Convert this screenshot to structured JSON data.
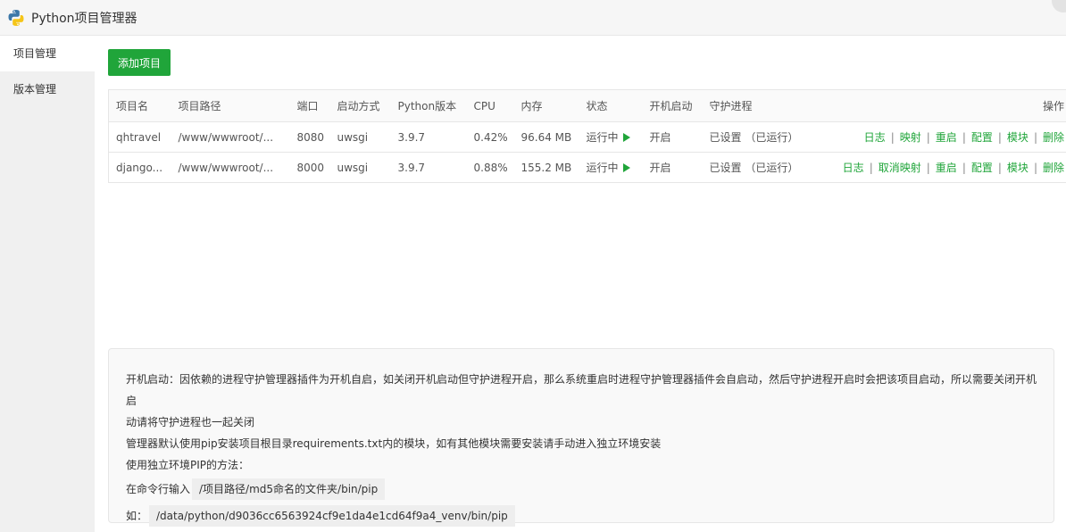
{
  "window": {
    "title": "Python项目管理器"
  },
  "sidebar": {
    "items": [
      {
        "label": "项目管理"
      },
      {
        "label": "版本管理"
      }
    ]
  },
  "toolbar": {
    "add_label": "添加项目"
  },
  "table": {
    "headers": [
      "项目名",
      "项目路径",
      "端口",
      "启动方式",
      "Python版本",
      "CPU",
      "内存",
      "状态",
      "开机启动",
      "守护进程",
      "操作"
    ],
    "rows": [
      {
        "name": "qhtravel",
        "path": "/www/wwwroot/...",
        "port": "8080",
        "method": "uwsgi",
        "version": "3.9.7",
        "cpu": "0.42%",
        "mem": "96.64 MB",
        "status": "运行中",
        "boot": "开启",
        "daemon": "已设置 （已运行）",
        "ops": [
          "日志",
          "映射",
          "重启",
          "配置",
          "模块",
          "删除"
        ]
      },
      {
        "name": "django...",
        "path": "/www/wwwroot/...",
        "port": "8000",
        "method": "uwsgi",
        "version": "3.9.7",
        "cpu": "0.88%",
        "mem": "155.2 MB",
        "status": "运行中",
        "boot": "开启",
        "daemon": "已设置 （已运行）",
        "ops": [
          "日志",
          "取消映射",
          "重启",
          "配置",
          "模块",
          "删除"
        ]
      }
    ],
    "separator": "|"
  },
  "tips": {
    "line1": "开机启动：因依赖的进程守护管理器插件为开机自启，如关闭开机启动但守护进程开启，那么系统重启时进程守护管理器插件会自启动，然后守护进程开启时会把该项目启动，所以需要关闭开机启",
    "line2": "动请将守护进程也一起关闭",
    "line3": "管理器默认使用pip安装项目根目录requirements.txt内的模块，如有其他模块需要安装请手动进入独立环境安装",
    "line4": "使用独立环境PIP的方法：",
    "line5_label": "在命令行输入",
    "line5_code": "/项目路径/md5命名的文件夹/bin/pip",
    "line6_label": "如：",
    "line6_code": "/data/python/d9036cc6563924cf9e1da4e1cd64f9a4_venv/bin/pip"
  },
  "colors": {
    "accent": "#20a53a",
    "sidebar_bg": "#f0f0f0"
  },
  "icons": {
    "app": "python-logo-icon",
    "running": "play-arrow-icon"
  }
}
